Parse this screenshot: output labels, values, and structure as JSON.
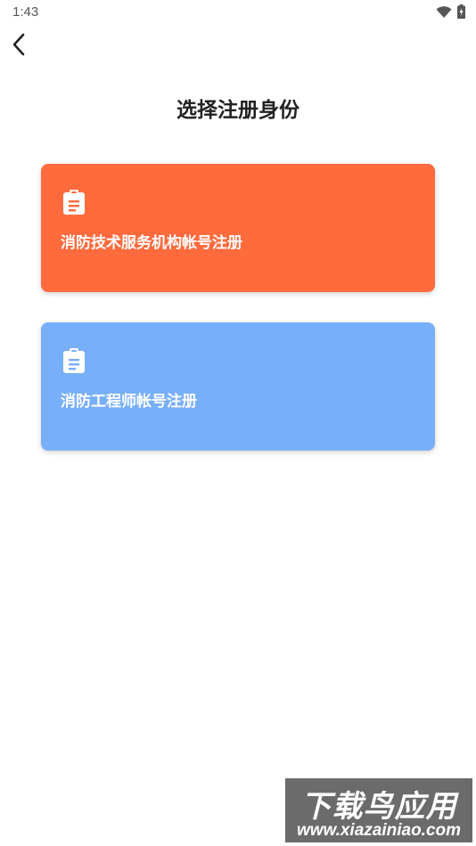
{
  "status_bar": {
    "time": "1:43",
    "icons": [
      "wifi-icon",
      "battery-charging-icon"
    ]
  },
  "header": {
    "back_icon": "chevron-left-icon"
  },
  "page": {
    "title": "选择注册身份"
  },
  "cards": [
    {
      "label": "消防技术服务机构帐号注册",
      "icon": "clipboard-icon",
      "color": "#FF6B3D"
    },
    {
      "label": "消防工程师帐号注册",
      "icon": "clipboard-icon",
      "color": "#78AFFB"
    }
  ],
  "watermark": {
    "line1": "下载鸟应用",
    "line2": "www.xiazainiao.com"
  }
}
